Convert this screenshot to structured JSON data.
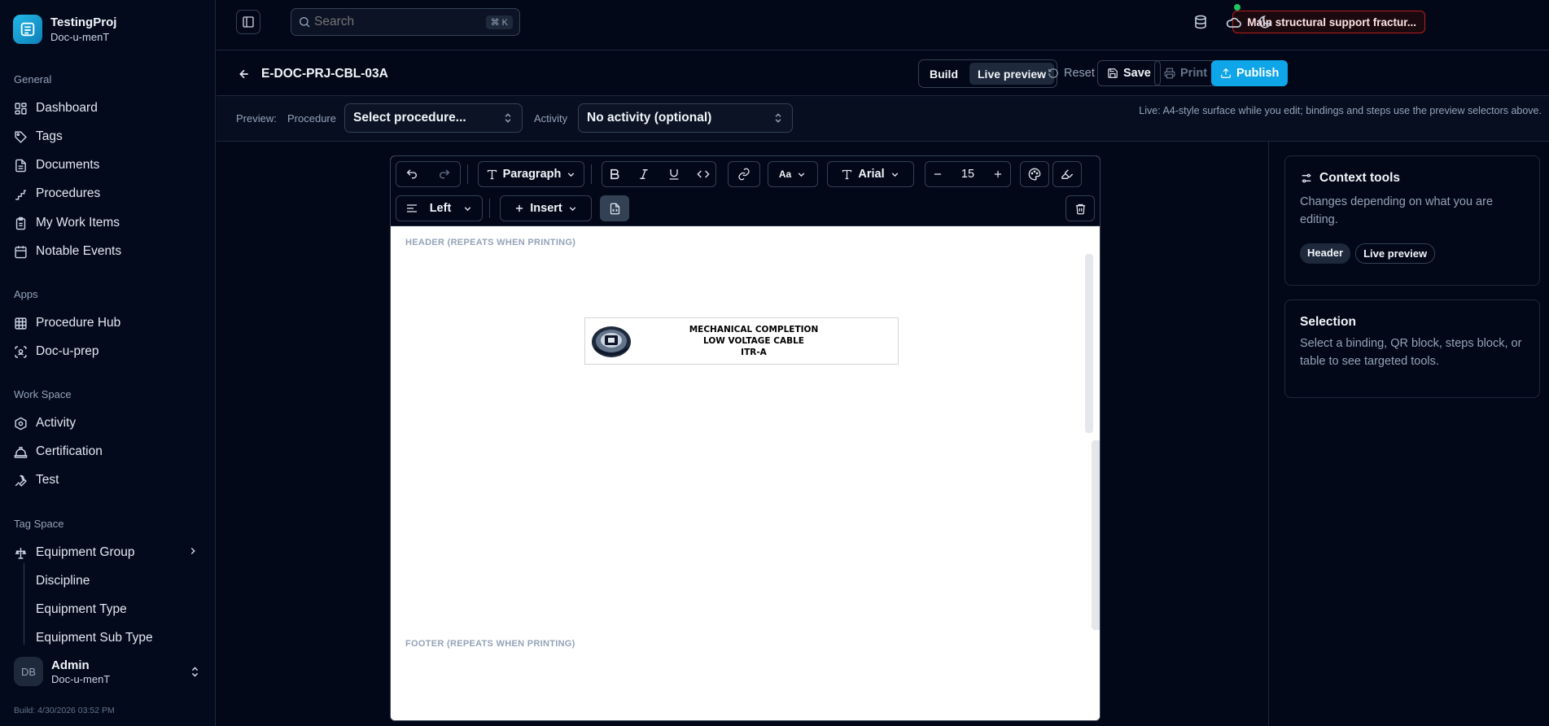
{
  "brand": {
    "name": "TestingProj",
    "subtitle": "Doc-u-menT"
  },
  "sidebar": {
    "general_title": "General",
    "general": [
      {
        "label": "Dashboard",
        "icon": "dashboard-icon"
      },
      {
        "label": "Tags",
        "icon": "tag-icon"
      },
      {
        "label": "Documents",
        "icon": "file-icon"
      },
      {
        "label": "Procedures",
        "icon": "stairs-icon"
      },
      {
        "label": "My Work Items",
        "icon": "clipboard-icon"
      },
      {
        "label": "Notable Events",
        "icon": "calendar-icon"
      }
    ],
    "apps_title": "Apps",
    "apps": [
      {
        "label": "Procedure Hub",
        "icon": "grid-icon"
      },
      {
        "label": "Doc-u-prep",
        "icon": "scan-face-icon"
      }
    ],
    "workspace_title": "Work Space",
    "workspace": [
      {
        "label": "Activity",
        "icon": "hexagon-icon"
      },
      {
        "label": "Certification",
        "icon": "hard-hat-icon"
      },
      {
        "label": "Test",
        "icon": "wrench-icon"
      }
    ],
    "tagspace_title": "Tag Space",
    "tagspace_group": {
      "label": "Equipment Group",
      "icon": "construction-icon"
    },
    "tagspace_sub": [
      "Discipline",
      "Equipment Type",
      "Equipment Sub Type"
    ],
    "user": {
      "initials": "DB",
      "name": "Admin",
      "org": "Doc-u-menT"
    },
    "build": "Build: 4/30/2026 03:52 PM"
  },
  "topbar": {
    "search_placeholder": "Search",
    "shortcut": "⌘ K",
    "alert": "Main structural support fractur..."
  },
  "doc": {
    "title": "E-DOC-PRJ-CBL-03A",
    "mode_build": "Build",
    "mode_live": "Live preview",
    "reset": "Reset",
    "save": "Save",
    "print": "Print",
    "publish": "Publish"
  },
  "preview": {
    "label": "Preview:",
    "procedure_label": "Procedure",
    "procedure_value": "Select procedure...",
    "activity_label": "Activity",
    "activity_value": "No activity (optional)",
    "note": "Live: A4-style surface while you edit; bindings and steps use the preview selectors above."
  },
  "toolbar": {
    "block_type": "Paragraph",
    "font_case": "Aa",
    "font": "Arial",
    "font_size": "15",
    "align": "Left",
    "insert": "Insert"
  },
  "page": {
    "header_label": "HEADER (REPEATS WHEN PRINTING)",
    "footer_label": "FOOTER (REPEATS WHEN PRINTING)",
    "banner_lines": [
      "MECHANICAL COMPLETION",
      "LOW VOLTAGE CABLE",
      "ITR-A"
    ]
  },
  "context": {
    "title": "Context tools",
    "text": "Changes depending on what you are editing.",
    "chip_header": "Header",
    "chip_live": "Live preview"
  },
  "selection": {
    "title": "Selection",
    "text": "Select a binding, QR block, steps block, or table to see targeted tools."
  },
  "colors": {
    "accent": "#0ea5e9",
    "alert_border": "#b91c1c",
    "online": "#22c55e"
  }
}
